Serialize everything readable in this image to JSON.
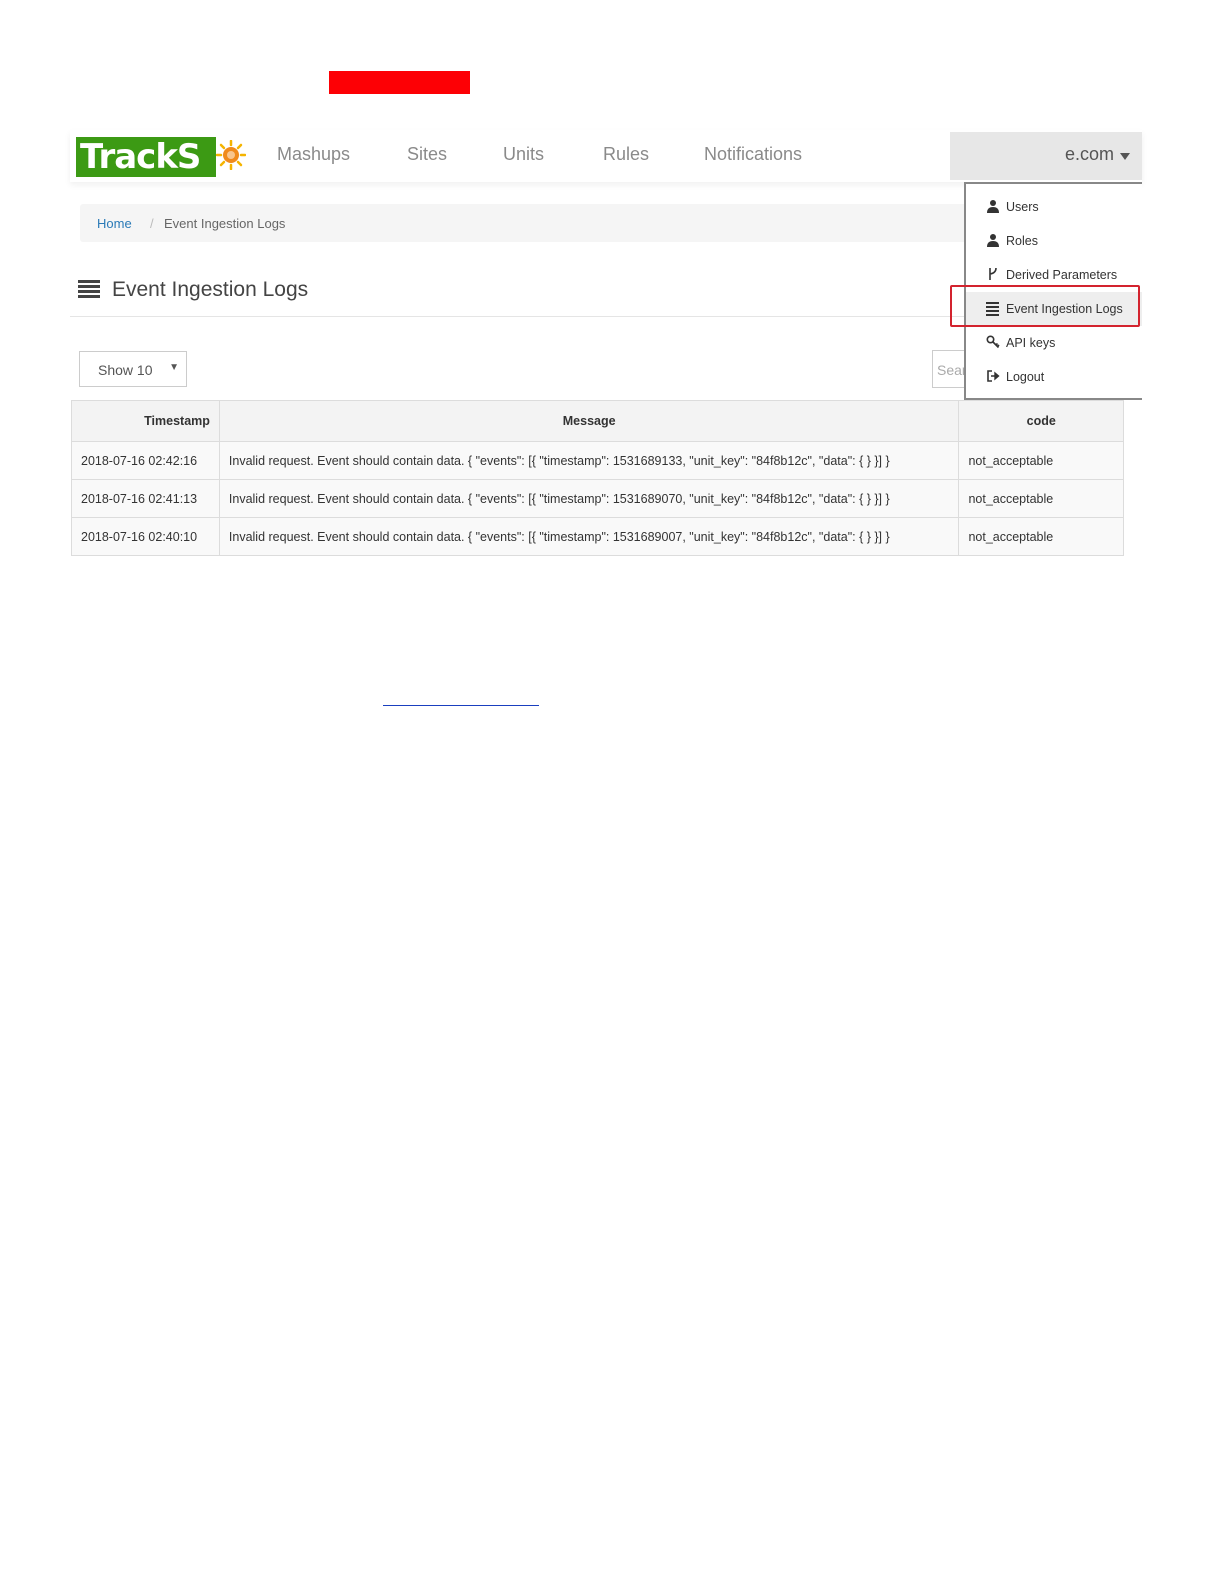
{
  "app": {
    "logo_text": "TrackS",
    "nav": [
      "Mashups",
      "Sites",
      "Units",
      "Rules",
      "Notifications"
    ],
    "user_email": "e.com"
  },
  "breadcrumb": {
    "home": "Home",
    "separator": "/",
    "current": "Event Ingestion Logs"
  },
  "page": {
    "title": "Event Ingestion Logs"
  },
  "controls": {
    "length_label": "Show 10",
    "length_caret": "▼",
    "search_placeholder": "Search"
  },
  "table": {
    "headers": [
      "Timestamp",
      "Message",
      "code"
    ],
    "rows": [
      [
        "2018-07-16 02:42:16",
        "Invalid request. Event should contain data. { \"events\": [{ \"timestamp\": 1531689133, \"unit_key\": \"84f8b12c\", \"data\": { } }] }",
        "not_acceptable"
      ],
      [
        "2018-07-16 02:41:13",
        "Invalid request. Event should contain data. { \"events\": [{ \"timestamp\": 1531689070, \"unit_key\": \"84f8b12c\", \"data\": { } }] }",
        "not_acceptable"
      ],
      [
        "2018-07-16 02:40:10",
        "Invalid request. Event should contain data. { \"events\": [{ \"timestamp\": 1531689007, \"unit_key\": \"84f8b12c\", \"data\": { } }] }",
        "not_acceptable"
      ]
    ]
  },
  "dropdown": {
    "items": [
      {
        "label": "Users",
        "icon": "user-icon"
      },
      {
        "label": "Roles",
        "icon": "user-icon"
      },
      {
        "label": "Derived Parameters",
        "icon": "fork-icon"
      },
      {
        "label": "Event Ingestion Logs",
        "icon": "list-icon"
      },
      {
        "label": "API keys",
        "icon": "key-icon"
      },
      {
        "label": "Logout",
        "icon": "logout-icon"
      }
    ]
  },
  "colors": {
    "brand_green": "#3c9a14",
    "link_blue": "#2a7ab7",
    "highlight_red": "#d3232e",
    "redaction_red": "#fd0005"
  }
}
